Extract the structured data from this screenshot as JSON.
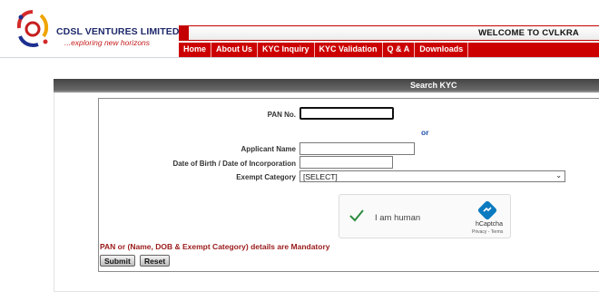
{
  "brand": {
    "title": "CDSL VENTURES LIMITED",
    "tagline": "...exploring new horizons",
    "logo_icon": "cdsl-swirl-logo-icon"
  },
  "header": {
    "welcome": "WELCOME TO CVLKRA"
  },
  "nav": {
    "items": [
      "Home",
      "About Us",
      "KYC Inquiry",
      "KYC Validation",
      "Q & A",
      "Downloads"
    ]
  },
  "panel": {
    "title": "Search KYC"
  },
  "form": {
    "pan_label": "PAN No.",
    "pan_value": "",
    "or_text": "or",
    "name_label": "Applicant Name",
    "name_value": "",
    "dob_label": "Date of Birth / Date of Incorporation",
    "dob_value": "",
    "exempt_label": "Exempt Category",
    "exempt_selected": "[SELECT]"
  },
  "captcha": {
    "label": "I am human",
    "brand": "hCaptcha",
    "terms": "Privacy - Terms"
  },
  "messages": {
    "mandatory": "PAN or (Name, DOB & Exempt Category) details are Mandatory"
  },
  "buttons": {
    "submit": "Submit",
    "reset": "Reset"
  },
  "colors": {
    "nav_red": "#cc0000",
    "link_blue": "#1f4fa8",
    "error_red": "#9a1a1a"
  }
}
